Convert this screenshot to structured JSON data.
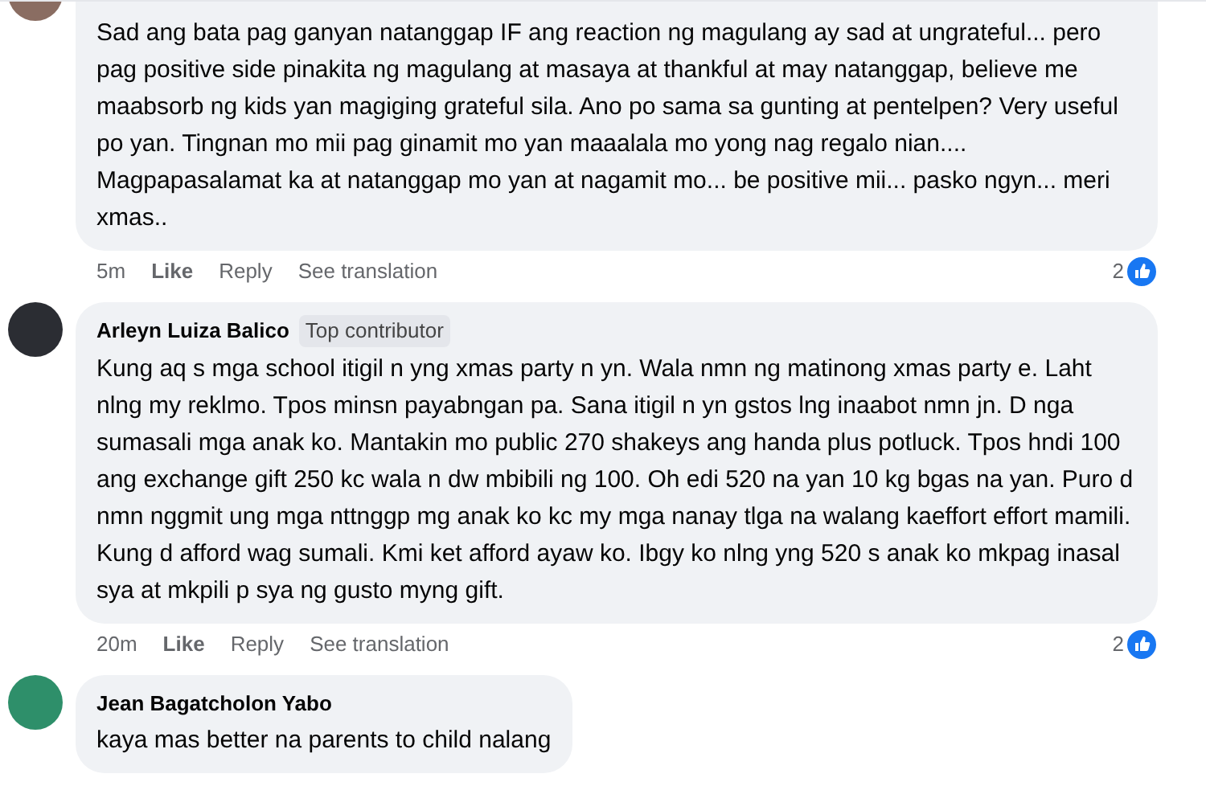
{
  "comments": [
    {
      "text": "Sad ang bata pag ganyan natanggap IF ang reaction ng magulang ay sad at ungrateful... pero pag positive side pinakita ng magulang at masaya at thankful at may natanggap, believe me maabsorb ng kids yan magiging grateful sila. Ano po sama sa gunting at pentelpen? Very useful po yan. Tingnan mo mii pag ginamit mo yan maaalala mo yong nag regalo nian.... Magpapasalamat ka at natanggap mo yan at nagamit mo... be positive mii... pasko ngyn... meri xmas..",
      "time": "5m",
      "actions": [
        "Like",
        "Reply",
        "See translation"
      ],
      "reactions": "2"
    },
    {
      "author": "Arleyn Luiza Balico",
      "badge": "Top contributor",
      "text": "Kung aq s mga school itigil n yng xmas party n yn. Wala nmn ng matinong xmas party e. Laht nlng my reklmo. Tpos minsn payabngan pa. Sana itigil n yn gstos lng inaabot nmn jn. D nga sumasali mga anak ko. Mantakin mo public 270 shakeys ang handa plus potluck. Tpos hndi 100 ang exchange gift 250 kc wala n dw mbibili ng 100. Oh edi 520 na yan 10 kg bgas na yan. Puro d nmn nggmit ung mga nttnggp mg anak ko kc my mga nanay tlga na walang kaeffort effort mamili. Kung d afford wag sumali. Kmi ket afford ayaw ko. Ibgy ko nlng yng 520 s anak ko mkpag inasal sya at mkpili p sya ng gusto myng gift.",
      "time": "20m",
      "actions": [
        "Like",
        "Reply",
        "See translation"
      ],
      "reactions": "2"
    },
    {
      "author": "Jean Bagatcholon Yabo",
      "text": "kaya mas better na parents to child nalang"
    }
  ]
}
